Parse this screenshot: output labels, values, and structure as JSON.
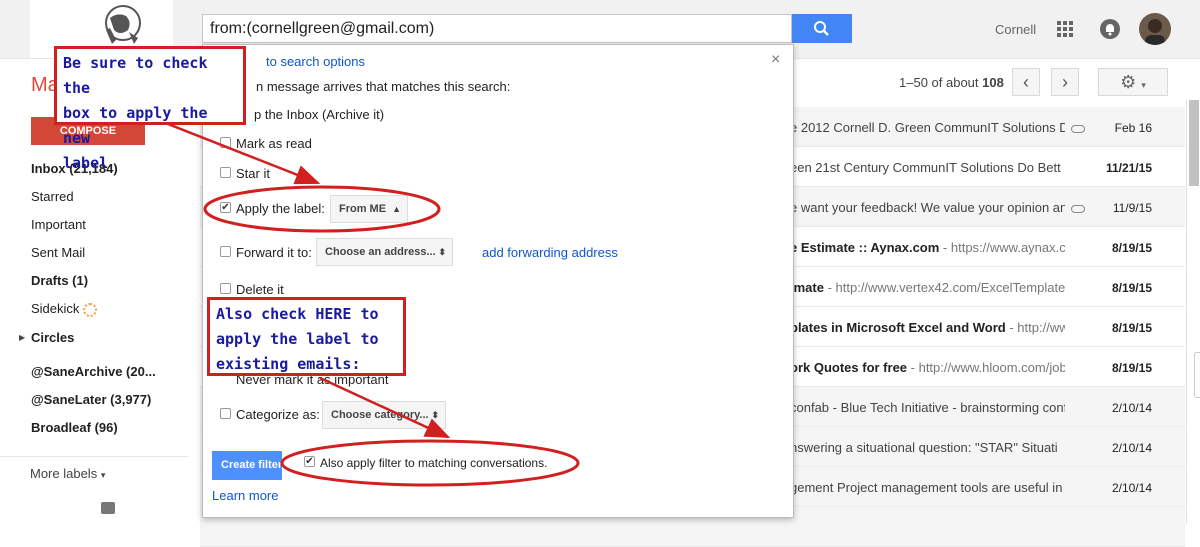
{
  "search": {
    "query": "from:(cornellgreen@gmail.com)"
  },
  "header": {
    "user_name": "Cornell"
  },
  "toolbar": {
    "mail_label": "Ma",
    "pager_range": "1–50 of about",
    "pager_total": "108"
  },
  "sidebar": {
    "compose_label": "COMPOSE",
    "items": [
      {
        "label": "Inbox (21,184)"
      },
      {
        "label": "Starred"
      },
      {
        "label": "Important"
      },
      {
        "label": "Sent Mail"
      },
      {
        "label": "Drafts (1)"
      },
      {
        "label": "Sidekick"
      },
      {
        "label": "Circles"
      },
      {
        "label": "@SaneArchive (20..."
      },
      {
        "label": "@SaneLater (3,977)"
      },
      {
        "label": "Broadleaf (96)"
      }
    ],
    "more_labels": "More labels"
  },
  "mail_rows": [
    {
      "text": "e 2012 Cornell D. Green CommunIT Solutions D",
      "date": "Feb 16"
    },
    {
      "text": "een 21st Century CommunIT Solutions Do Bett",
      "date": "11/21/15"
    },
    {
      "text": "e want your feedback! We value your opinion an",
      "date": "11/9/15"
    },
    {
      "text": "e Estimate :: Aynax.com",
      "snippet": " - https://www.aynax.c",
      "date": "8/19/15"
    },
    {
      "text": "imate",
      "snippet": " - http://www.vertex42.com/ExcelTemplate",
      "date": "8/19/15"
    },
    {
      "text": "plates in Microsoft Excel and Word",
      "snippet": " - http://ww",
      "date": "8/19/15"
    },
    {
      "text": "ork Quotes for free",
      "snippet": " - http://www.hloom.com/job",
      "date": "8/19/15"
    },
    {
      "text": "confab - Blue Tech Initiative - brainstorming conf",
      "date": "2/10/14"
    },
    {
      "text": "nswering a situational question: \"STAR\" Situati",
      "date": "2/10/14"
    },
    {
      "text": "gement Project management tools are useful in",
      "date": "2/10/14"
    }
  ],
  "filter_dialog": {
    "back_link": "to search options",
    "intro": "n message arrives that matches this search:",
    "skip_inbox": "p the Inbox (Archive it)",
    "mark_read": "Mark as read",
    "star_it": "Star it",
    "apply_label": "Apply the label:",
    "apply_label_value": "From ME",
    "forward_it": "Forward it to:",
    "forward_value": "Choose an address...",
    "add_forwarding": "add forwarding address",
    "delete_it": "Delete it",
    "never_important": "Never mark it as important",
    "categorize": "Categorize as:",
    "categorize_value": "Choose category...",
    "create_button": "Create filter",
    "also_apply": "Also apply filter to matching conversations.",
    "learn_more": "Learn more"
  },
  "annotations": {
    "callout_top": [
      "Be sure to check the",
      "box to apply the new",
      "label"
    ],
    "callout_bottom": [
      "Also check HERE to",
      "apply the label to",
      "existing emails:"
    ]
  },
  "colors": {
    "accent_blue": "#4285f4",
    "compose_red": "#d14836",
    "annotation_red": "#d21f1f",
    "annotation_text": "#1a1aa0"
  }
}
